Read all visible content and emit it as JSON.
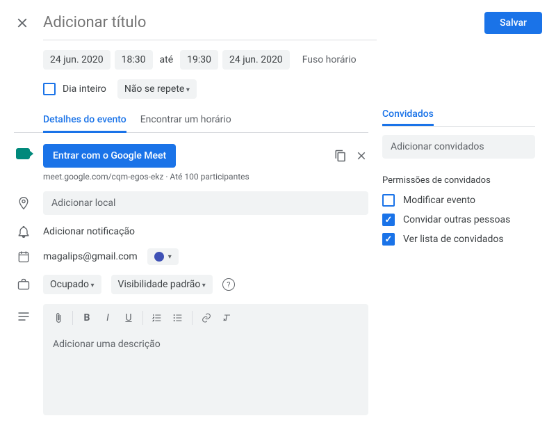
{
  "header": {
    "title_placeholder": "Adicionar título",
    "save_label": "Salvar"
  },
  "datetime": {
    "start_date": "24 jun. 2020",
    "start_time": "18:30",
    "to_label": "até",
    "end_time": "19:30",
    "end_date": "24 jun. 2020",
    "timezone_label": "Fuso horário",
    "allday_label": "Dia inteiro",
    "repeat_label": "Não se repete"
  },
  "tabs": {
    "details": "Detalhes do evento",
    "findtime": "Encontrar um horário"
  },
  "meet": {
    "button_label": "Entrar com o Google Meet",
    "sub": "meet.google.com/cqm-egos-ekz · Até 100 participantes"
  },
  "location": {
    "placeholder": "Adicionar local"
  },
  "notification": {
    "label": "Adicionar notificação"
  },
  "calendar": {
    "email": "magalips@gmail.com"
  },
  "visibility": {
    "busy_label": "Ocupado",
    "visibility_label": "Visibilidade padrão"
  },
  "description": {
    "placeholder": "Adicionar uma descrição"
  },
  "guests": {
    "header": "Convidados",
    "input_placeholder": "Adicionar convidados",
    "permissions_title": "Permissões de convidados",
    "permissions": [
      {
        "label": "Modificar evento",
        "checked": false
      },
      {
        "label": "Convidar outras pessoas",
        "checked": true
      },
      {
        "label": "Ver lista de convidados",
        "checked": true
      }
    ]
  }
}
